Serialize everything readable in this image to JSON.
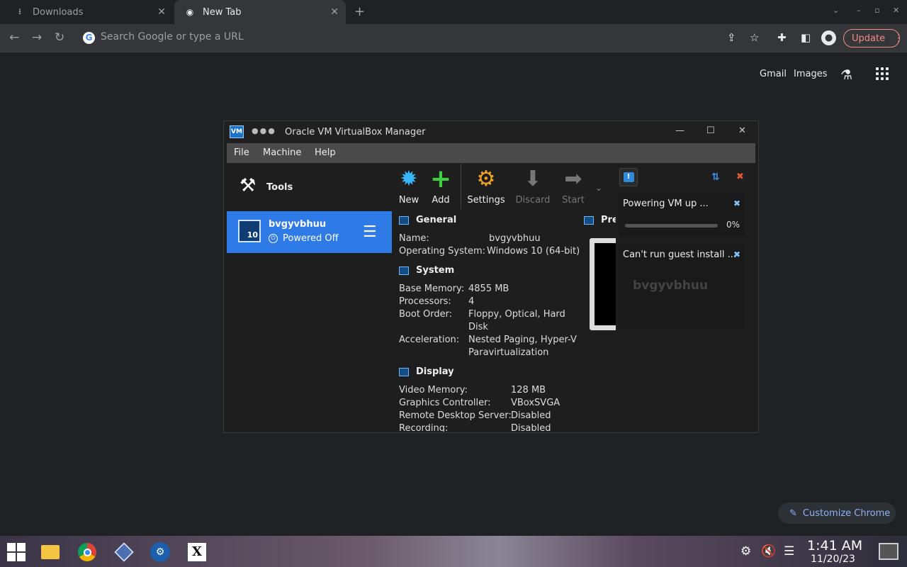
{
  "browser": {
    "tabs": [
      {
        "label": "Downloads",
        "icon": "download-icon"
      },
      {
        "label": "New Tab",
        "icon": "chrome-icon"
      }
    ],
    "omnibox_placeholder": "Search Google or type a URL",
    "update_label": "Update",
    "ntp": {
      "gmail": "Gmail",
      "images": "Images",
      "customize": "Customize Chrome"
    }
  },
  "vbox": {
    "title": "Oracle VM VirtualBox Manager",
    "logo_text": "VM",
    "menu": [
      "File",
      "Machine",
      "Help"
    ],
    "tools_label": "Tools",
    "vm": {
      "name": "bvgyvbhuu",
      "state": "Powered Off",
      "os_badge": "10"
    },
    "toolbar": [
      "New",
      "Add",
      "Settings",
      "Discard",
      "Start"
    ],
    "details": {
      "general": {
        "title": "General",
        "rows": [
          {
            "k": "Name:",
            "v": "bvgyvbhuu"
          },
          {
            "k": "Operating System:",
            "v": "Windows 10 (64-bit)"
          }
        ]
      },
      "system": {
        "title": "System",
        "rows": [
          {
            "k": "Base Memory:",
            "v": "4855 MB"
          },
          {
            "k": "Processors:",
            "v": "4"
          },
          {
            "k": "Boot Order:",
            "v": "Floppy, Optical, Hard",
            "v2": "Disk"
          },
          {
            "k": "Acceleration:",
            "v": "Nested Paging, Hyper-V",
            "v2": "Paravirtualization"
          }
        ]
      },
      "display": {
        "title": "Display",
        "rows": [
          {
            "k": "Video Memory:",
            "v": "128 MB"
          },
          {
            "k": "Graphics Controller:",
            "v": "VBoxSVGA"
          },
          {
            "k": "Remote Desktop Server:",
            "v": "Disabled"
          },
          {
            "k": "Recording:",
            "v": "Disabled"
          }
        ]
      }
    },
    "preview": {
      "title": "Pre",
      "vm_name": "bvgyvbhuu"
    },
    "notifications": [
      {
        "text": "Powering VM up ...",
        "progress_text": "0%",
        "progress": 0
      },
      {
        "text": "Can't run guest install ..."
      }
    ]
  },
  "taskbar": {
    "time": "1:41 AM",
    "date": "11/20/23"
  },
  "colors": {
    "accent_selection": "#2e7be8",
    "update_red": "#f28b82",
    "link_blue": "#8ab4f8"
  }
}
